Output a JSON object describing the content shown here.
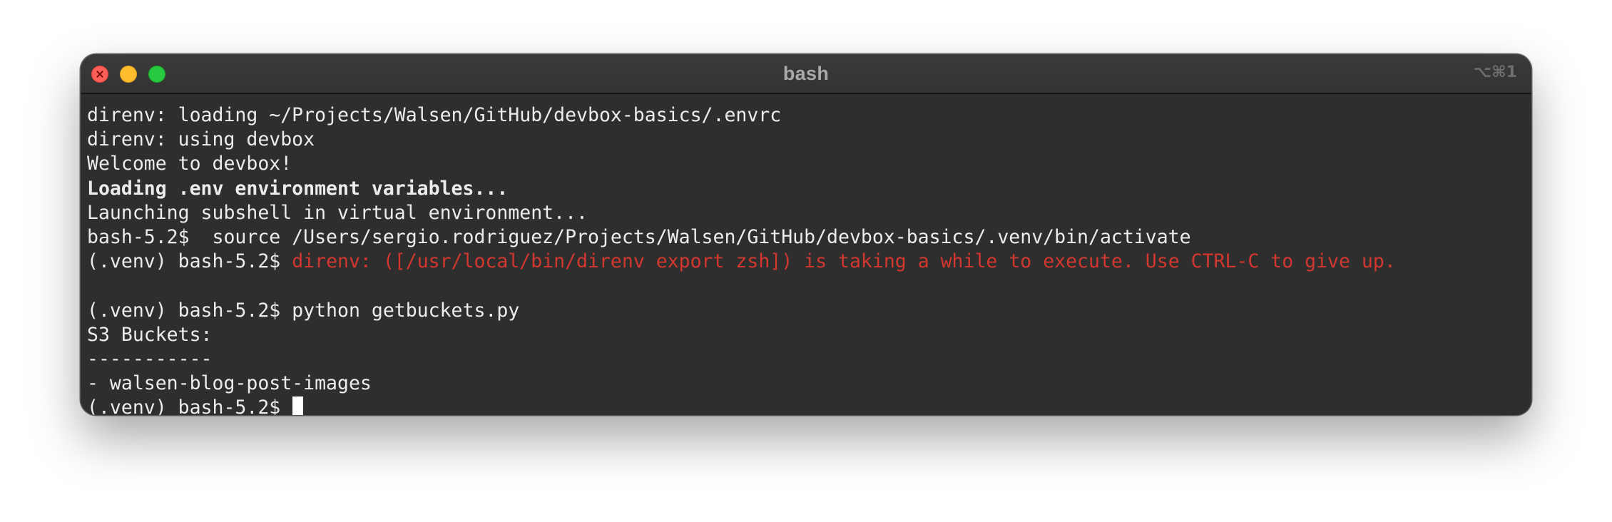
{
  "window": {
    "title": "bash",
    "shortcut": "⌥⌘1"
  },
  "colors": {
    "background": "#2e2e2e",
    "text": "#ececec",
    "error_red": "#d1372f",
    "close_light": "#ff5f57",
    "minimize_light": "#febc2e",
    "maximize_light": "#28c840"
  },
  "terminal": {
    "lines": [
      {
        "text": "direnv: loading ~/Projects/Walsen/GitHub/devbox-basics/.envrc"
      },
      {
        "text": "direnv: using devbox"
      },
      {
        "text": "Welcome to devbox!"
      },
      {
        "text": "Loading .env environment variables..."
      },
      {
        "text": "Launching subshell in virtual environment..."
      },
      {
        "prompt": "bash-5.2$",
        "command": "  source /Users/sergio.rodriguez/Projects/Walsen/GitHub/devbox-basics/.venv/bin/activate"
      },
      {
        "prompt": "(.venv) bash-5.2$",
        "output": "direnv: ([/usr/local/bin/direnv export zsh]) is taking a while to execute. Use CTRL-C to give up."
      },
      {
        "text": ""
      },
      {
        "prompt": "(.venv) bash-5.2$",
        "command": " python getbuckets.py"
      },
      {
        "text": "S3 Buckets:"
      },
      {
        "text": "-----------"
      },
      {
        "text": "- walsen-blog-post-images"
      },
      {
        "prompt": "(.venv) bash-5.2$",
        "command": " "
      }
    ]
  }
}
